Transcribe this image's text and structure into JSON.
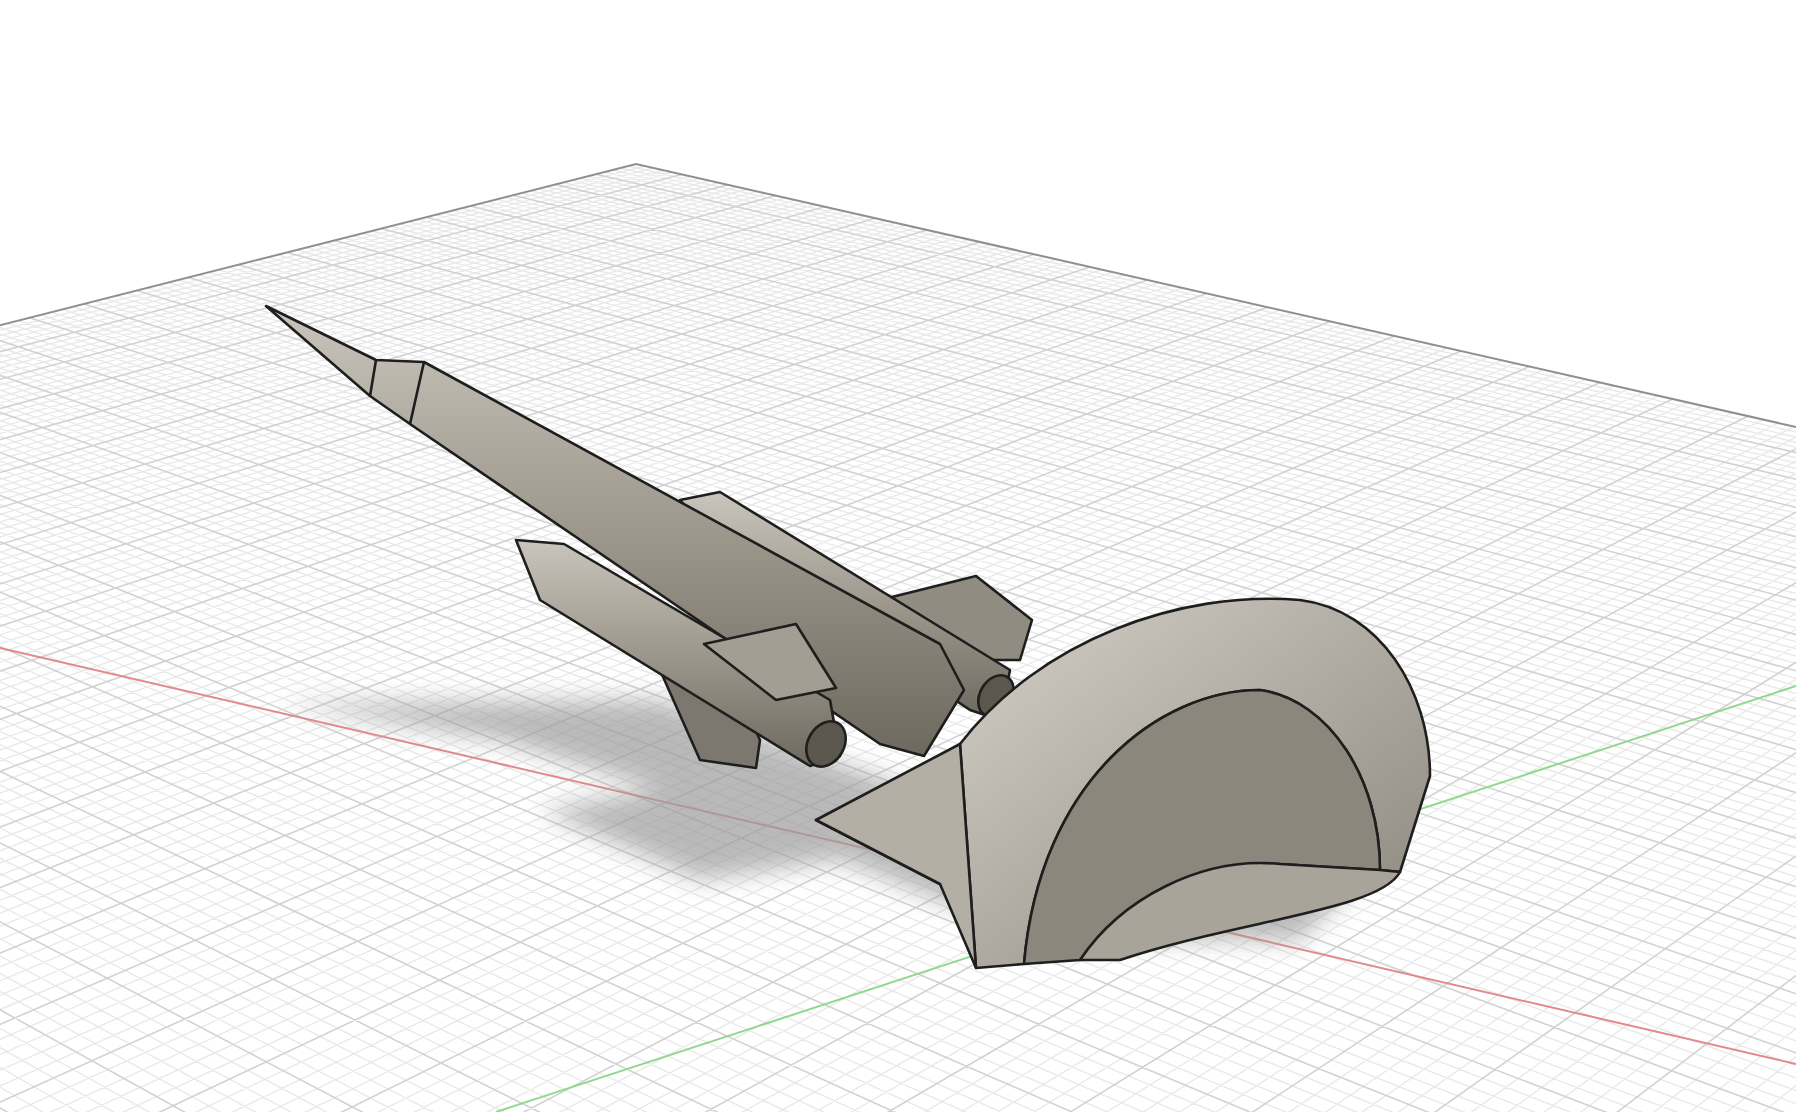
{
  "viewport": {
    "grid_visible": true,
    "ground_shadow": true
  }
}
